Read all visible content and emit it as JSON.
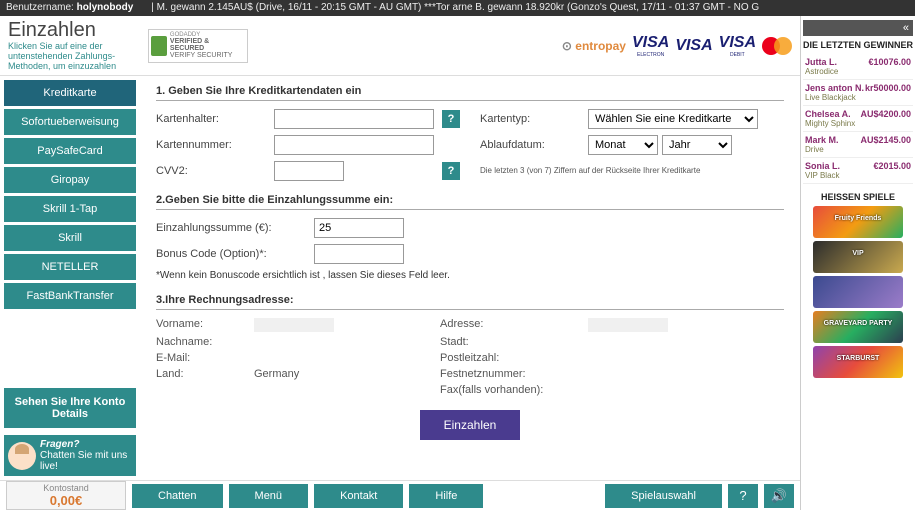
{
  "topbar": {
    "username_label": "Benutzername:",
    "username": "holynobody",
    "ticker": "| M. gewann 2.145AU$ (Drive, 16/11 - 20:15 GMT - AU GMT) ***Tor arne B. gewann 18.920kr (Gonzo's Quest, 17/11 - 01:37 GMT - NO G"
  },
  "header": {
    "title": "Einzahlen",
    "subtitle": "Klicken Sie auf eine der untenstehenden Zahlungs-Methoden, um einzuzahlen",
    "ssl_text": "VERIFIED & SECURED",
    "ssl_sub": "VERIFY SECURITY",
    "entropay": "entropay",
    "visa": "VISA",
    "visa_electron_sub": "ELECTRON",
    "visa_debit_sub": "DEBIT"
  },
  "sidebar": {
    "items": [
      {
        "label": "Kreditkarte",
        "active": true
      },
      {
        "label": "Sofortueberweisung"
      },
      {
        "label": "PaySafeCard"
      },
      {
        "label": "Giropay"
      },
      {
        "label": "Skrill 1-Tap"
      },
      {
        "label": "Skrill"
      },
      {
        "label": "NETELLER"
      },
      {
        "label": "FastBankTransfer"
      }
    ],
    "account_box": "Sehen Sie Ihre Konto Details",
    "chat_title": "Fragen?",
    "chat_sub": "Chatten Sie mit uns live!"
  },
  "form": {
    "s1": "1. Geben Sie Ihre Kreditkartendaten ein",
    "cardholder_lbl": "Kartenhalter:",
    "cardnumber_lbl": "Kartennummer:",
    "cvv_lbl": "CVV2:",
    "cvv_note": "Die letzten 3 (von 7) Ziffern auf der Rückseite Ihrer Kreditkarte",
    "cardtype_lbl": "Kartentyp:",
    "cardtype_select": "Wählen Sie eine Kreditkarte",
    "expiry_lbl": "Ablaufdatum:",
    "month": "Monat",
    "year": "Jahr",
    "s2": "2.Geben Sie bitte die Einzahlungssumme ein:",
    "amount_lbl": "Einzahlungssumme (€):",
    "amount_val": "25",
    "bonus_lbl": "Bonus Code (Option)*:",
    "bonus_note": "*Wenn kein Bonuscode ersichtlich ist , lassen Sie dieses Feld leer.",
    "s3": "3.Ihre Rechnungsadresse:",
    "firstname_lbl": "Vorname:",
    "lastname_lbl": "Nachname:",
    "email_lbl": "E-Mail:",
    "country_lbl": "Land:",
    "country_val": "Germany",
    "address_lbl": "Adresse:",
    "city_lbl": "Stadt:",
    "zip_lbl": "Postleitzahl:",
    "phone_lbl": "Festnetznummer:",
    "fax_lbl": "Fax(falls vorhanden):",
    "submit": "Einzahlen"
  },
  "bottom": {
    "balance_lbl": "Kontostand",
    "balance_val": "0,00€",
    "chat": "Chatten",
    "menu": "Menü",
    "contact": "Kontakt",
    "help": "Hilfe",
    "games": "Spielauswahl",
    "q": "?"
  },
  "right": {
    "close": "«",
    "winners_h": "DIE LETZTEN GEWINNER",
    "winners": [
      {
        "name": "Jutta L.",
        "amount": "€10076.00",
        "game": "Astrodice"
      },
      {
        "name": "Jens anton N.",
        "amount": "kr50000.00",
        "game": "Live Blackjack"
      },
      {
        "name": "Chelsea A.",
        "amount": "AU$4200.00",
        "game": "Mighty Sphinx"
      },
      {
        "name": "Mark M.",
        "amount": "AU$2145.00",
        "game": "Drive"
      },
      {
        "name": "Sonia L.",
        "amount": "€2015.00",
        "game": "VIP Black"
      }
    ],
    "hot_h": "HEISSEN SPIELE",
    "games": [
      {
        "cls": "g1",
        "label": "Fruity Friends"
      },
      {
        "cls": "g2",
        "label": "VIP"
      },
      {
        "cls": "g3",
        "label": ""
      },
      {
        "cls": "g4",
        "label": "GRAVEYARD PARTY"
      },
      {
        "cls": "g5",
        "label": "STARBURST"
      }
    ]
  }
}
